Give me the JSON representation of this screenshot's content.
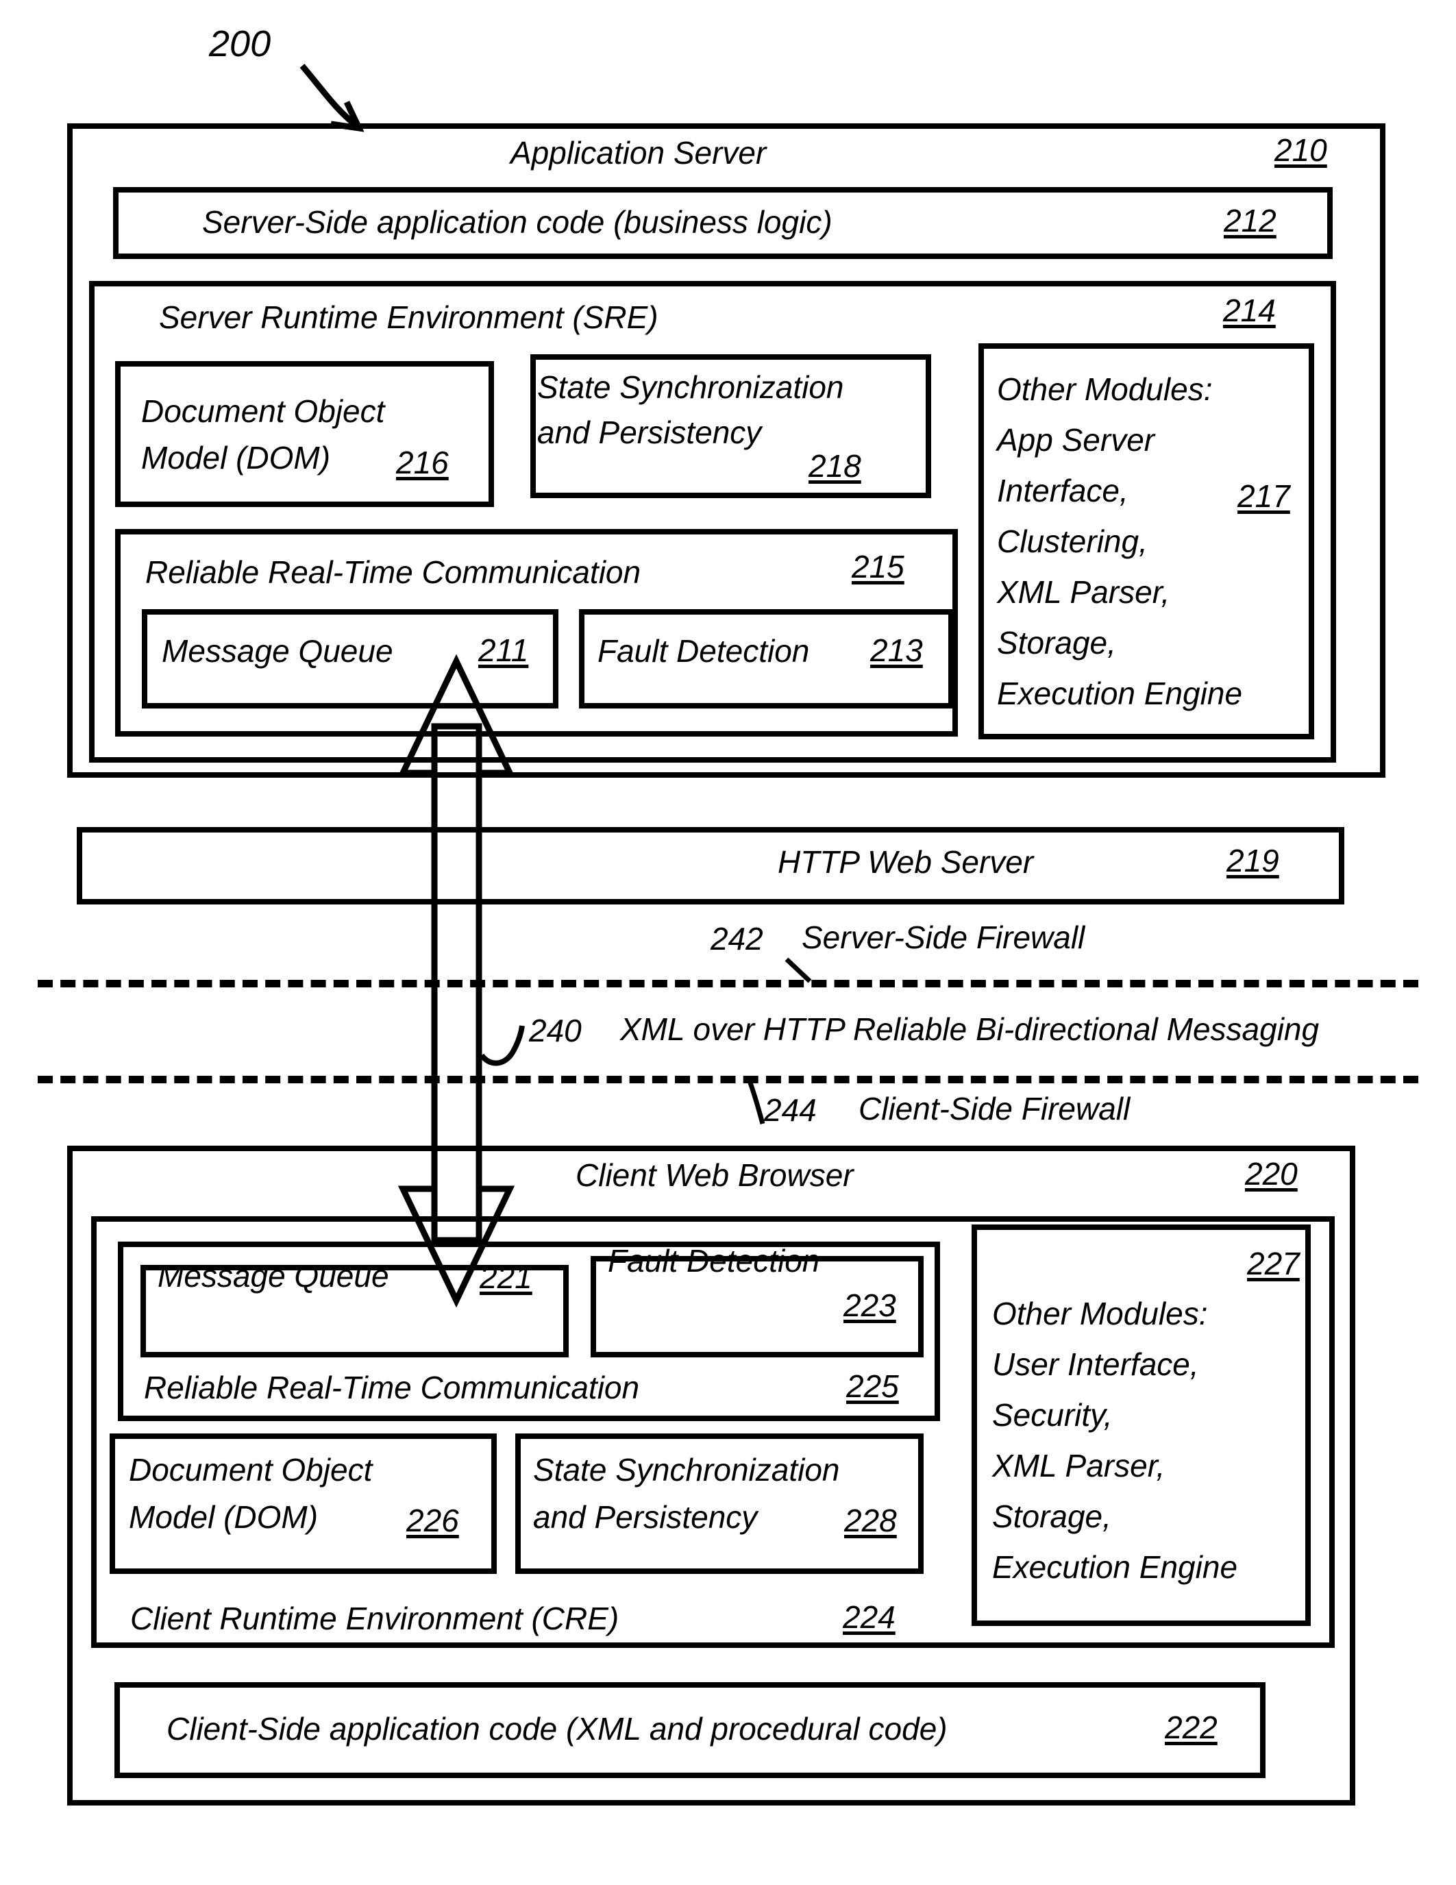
{
  "figure": {
    "number": "200"
  },
  "server": {
    "title": "Application Server",
    "ref": "210",
    "app_code": {
      "label": "Server-Side application code (business logic)",
      "ref": "212"
    },
    "sre": {
      "label": "Server Runtime Environment (SRE)",
      "ref": "214",
      "dom": {
        "line1": "Document Object",
        "line2": "Model (DOM)",
        "ref": "216"
      },
      "state_sync": {
        "line1": "State Synchronization",
        "line2": "and Persistency",
        "ref": "218"
      },
      "other_modules": {
        "lines": [
          "Other Modules:",
          "App Server",
          "Interface,",
          "Clustering,",
          "XML Parser,",
          "Storage,",
          "Execution Engine"
        ],
        "ref": "217"
      },
      "rrtc": {
        "label": "Reliable Real-Time Communication",
        "ref": "215",
        "message_queue": {
          "label": "Message Queue",
          "ref": "211"
        },
        "fault_detection": {
          "label": "Fault Detection",
          "ref": "213"
        }
      }
    }
  },
  "web_server": {
    "label": "HTTP Web Server",
    "ref": "219"
  },
  "firewalls": {
    "server_side": {
      "ref": "242",
      "label": "Server-Side Firewall"
    },
    "client_side": {
      "ref": "244",
      "label": "Client-Side Firewall"
    }
  },
  "channel": {
    "ref": "240",
    "label": "XML over HTTP Reliable Bi-directional Messaging"
  },
  "client": {
    "title": "Client Web Browser",
    "ref": "220",
    "cre": {
      "label": "Client Runtime Environment (CRE)",
      "ref": "224",
      "rrtc": {
        "label": "Reliable Real-Time Communication",
        "ref": "225",
        "message_queue": {
          "label": "Message Queue",
          "ref": "221"
        },
        "fault_detection": {
          "label": "Fault Detection",
          "ref": "223"
        }
      },
      "dom": {
        "line1": "Document Object",
        "line2": "Model (DOM)",
        "ref": "226"
      },
      "state_sync": {
        "line1": "State Synchronization",
        "line2": "and Persistency",
        "ref": "228"
      },
      "other_modules": {
        "lines": [
          "Other Modules:",
          "User Interface,",
          "Security,",
          "XML Parser,",
          "Storage,",
          "Execution Engine"
        ],
        "ref": "227"
      }
    },
    "app_code": {
      "label": "Client-Side application code (XML and procedural code)",
      "ref": "222"
    }
  }
}
